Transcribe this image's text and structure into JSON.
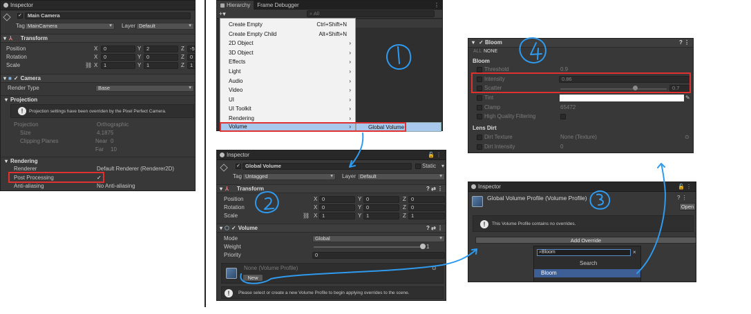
{
  "p1": {
    "title": "Inspector",
    "object_name": "Main Camera",
    "tag_label": "Tag",
    "tag_value": "MainCamera",
    "layer_label": "Layer",
    "layer_value": "Default",
    "transform_header": "Transform",
    "position_label": "Position",
    "rotation_label": "Rotation",
    "scale_label": "Scale",
    "axis_x": "X",
    "axis_y": "Y",
    "axis_z": "Z",
    "pos": {
      "x": "0",
      "y": "2",
      "z": "-5"
    },
    "rot": {
      "x": "0",
      "y": "0",
      "z": "0"
    },
    "scl": {
      "x": "1",
      "y": "1",
      "z": "1"
    },
    "camera_header": "Camera",
    "render_type_label": "Render Type",
    "render_type_value": "Base",
    "projection_header": "Projection",
    "projection_note": "Projection settings have been overriden by the Pixel Perfect Camera.",
    "projection_label": "Projection",
    "projection_value": "Orthographic",
    "size_label": "Size",
    "size_value": "4.1875",
    "clipping_label": "Clipping Planes",
    "near_label": "Near",
    "near_value": "0",
    "far_label": "Far",
    "far_value": "10",
    "rendering_header": "Rendering",
    "renderer_label": "Renderer",
    "renderer_value": "Default Renderer (Renderer2D)",
    "post_processing_label": "Post Processing",
    "post_processing_check": "✓",
    "anti_aliasing_label": "Anti-aliasing",
    "anti_aliasing_value": "No Anti-aliasing"
  },
  "p2": {
    "tab_hierarchy": "Hierarchy",
    "tab_frame_debugger": "Frame Debugger",
    "add_label": "+▾",
    "search_placeholder": "All",
    "menu_items": [
      {
        "label": "Create Empty",
        "shortcut": "Ctrl+Shift+N",
        "arrow": ""
      },
      {
        "label": "Create Empty Child",
        "shortcut": "Alt+Shift+N",
        "arrow": ""
      },
      {
        "label": "2D Object",
        "shortcut": "",
        "arrow": "›"
      },
      {
        "label": "3D Object",
        "shortcut": "",
        "arrow": "›"
      },
      {
        "label": "Effects",
        "shortcut": "",
        "arrow": "›"
      },
      {
        "label": "Light",
        "shortcut": "",
        "arrow": "›"
      },
      {
        "label": "Audio",
        "shortcut": "",
        "arrow": "›"
      },
      {
        "label": "Video",
        "shortcut": "",
        "arrow": "›"
      },
      {
        "label": "UI",
        "shortcut": "",
        "arrow": "›"
      },
      {
        "label": "UI Toolkit",
        "shortcut": "",
        "arrow": "›"
      },
      {
        "label": "Rendering",
        "shortcut": "",
        "arrow": "›"
      },
      {
        "label": "Volume",
        "shortcut": "",
        "arrow": "›"
      }
    ],
    "submenu_item": "Global Volume"
  },
  "p3": {
    "title": "Inspector",
    "object_name": "Global Volume",
    "static_label": "Static",
    "tag_label": "Tag",
    "tag_value": "Untagged",
    "layer_label": "Layer",
    "layer_value": "Default",
    "transform_header": "Transform",
    "position_label": "Position",
    "rotation_label": "Rotation",
    "scale_label": "Scale",
    "axis_x": "X",
    "axis_y": "Y",
    "axis_z": "Z",
    "pos": {
      "x": "0",
      "y": "0",
      "z": "0"
    },
    "rot": {
      "x": "0",
      "y": "0",
      "z": "0"
    },
    "scl": {
      "x": "1",
      "y": "1",
      "z": "1"
    },
    "volume_header": "Volume",
    "mode_label": "Mode",
    "mode_value": "Global",
    "weight_label": "Weight",
    "weight_value": "1",
    "weight_fraction": 1,
    "priority_label": "Priority",
    "priority_value": "0",
    "profile_label": "None (Volume Profile)",
    "new_button": "New",
    "help_text": "Please select or create a new Volume Profile to begin applying overrides to the scene."
  },
  "p4": {
    "title": "Inspector",
    "profile_title": "Global Volume Profile (Volume Profile)",
    "open_button": "Open",
    "note": "This Volume Profile contains no overrides.",
    "add_override_button": "Add Override",
    "search_value": "Bloom",
    "search_heading": "Search",
    "result_item": "Bloom"
  },
  "p5": {
    "header": "Bloom",
    "all_label": "ALL",
    "none_label": "NONE",
    "section_bloom": "Bloom",
    "threshold_label": "Threshold",
    "threshold_value": "0.9",
    "intensity_label": "Intensity",
    "intensity_value": "0.86",
    "scatter_label": "Scatter",
    "scatter_value": "0.7",
    "scatter_fraction": 0.7,
    "tint_label": "Tint",
    "clamp_label": "Clamp",
    "clamp_value": "65472",
    "hq_label": "High Quality Filtering",
    "section_lens": "Lens Dirt",
    "dirt_texture_label": "Dirt Texture",
    "dirt_texture_value": "None (Texture)",
    "dirt_intensity_label": "Dirt Intensity",
    "dirt_intensity_value": "0"
  },
  "colors": {
    "panel_bg": "#383838",
    "annotation_blue": "#2e9bf0",
    "highlight_red": "#e03131",
    "menu_highlight": "#a8c8ec",
    "selection_blue": "#3d5f96"
  },
  "icons": [
    "info-icon",
    "cube-icon",
    "transform-icon",
    "camera-icon",
    "lock-icon",
    "menu-dots-icon",
    "help-icon",
    "settings-icon",
    "link-icon",
    "volume-icon",
    "search-icon",
    "clear-icon",
    "eyedropper-icon"
  ]
}
